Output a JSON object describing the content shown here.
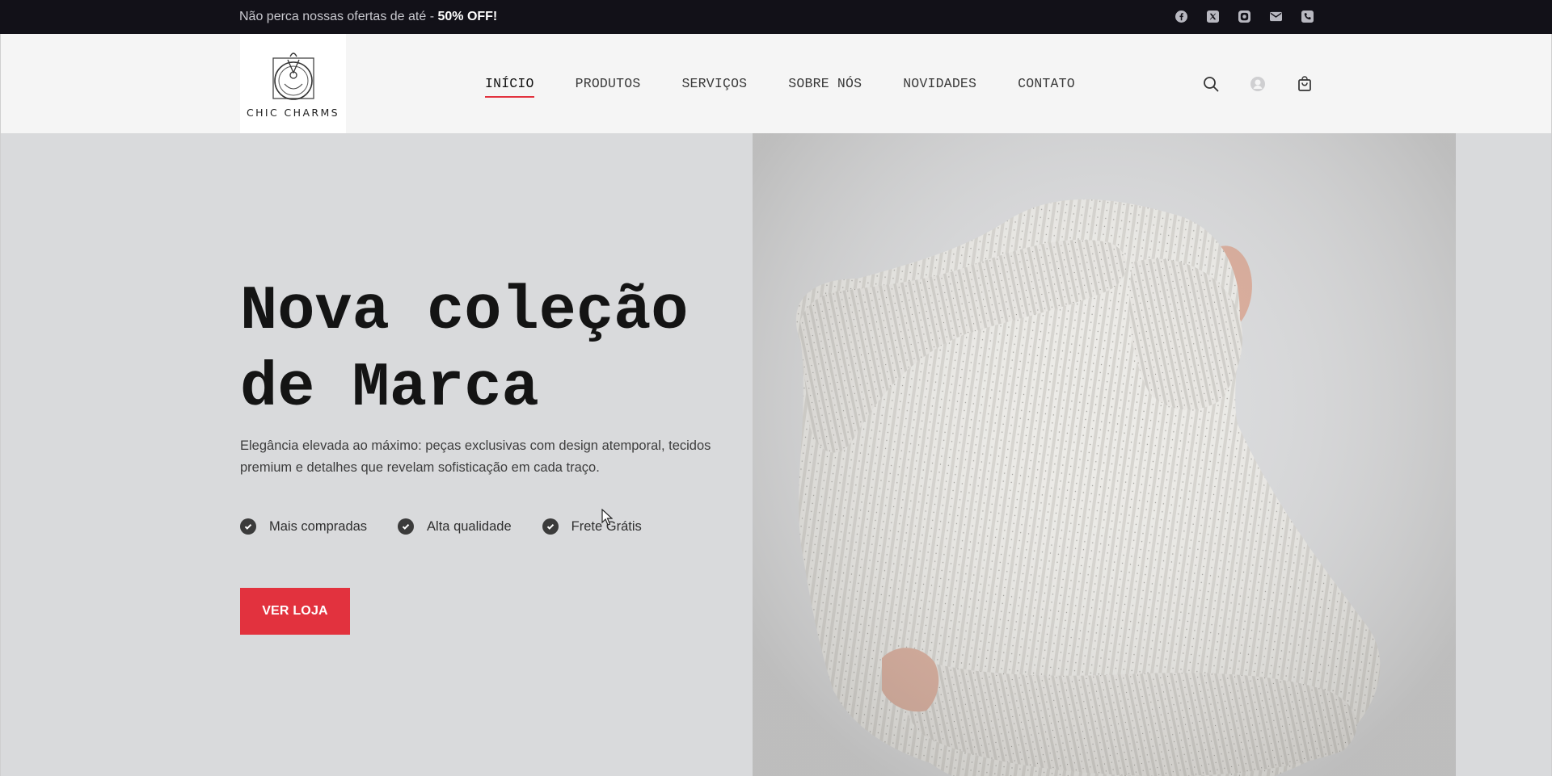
{
  "topbar": {
    "promo_text": "Não perca nossas ofertas de até - ",
    "promo_highlight": "50% OFF!",
    "social_icons": [
      "facebook-icon",
      "x-icon",
      "instagram-icon",
      "email-icon",
      "phone-icon"
    ]
  },
  "header": {
    "logo_text": "CHIC CHARMS",
    "nav": [
      {
        "label": "INÍCIO",
        "active": true
      },
      {
        "label": "PRODUTOS"
      },
      {
        "label": "SERVIÇOS"
      },
      {
        "label": "SOBRE NÓS"
      },
      {
        "label": "NOVIDADES"
      },
      {
        "label": "CONTATO"
      }
    ],
    "icons": [
      "search-icon",
      "user-icon",
      "cart-icon"
    ]
  },
  "hero": {
    "title_line1": "Nova coleção",
    "title_line2": "de Marca",
    "description": "Elegância elevada ao máximo: peças exclusivas com design atemporal, tecidos premium e detalhes que revelam sofisticação em cada traço.",
    "features": [
      "Mais compradas",
      "Alta qualidade",
      "Frete Grátis"
    ],
    "cta_label": "VER LOJA"
  },
  "colors": {
    "accent": "#e2323e",
    "topbar_bg": "#121118",
    "hero_bg": "#d9dadc",
    "header_bg": "#f5f5f5"
  }
}
